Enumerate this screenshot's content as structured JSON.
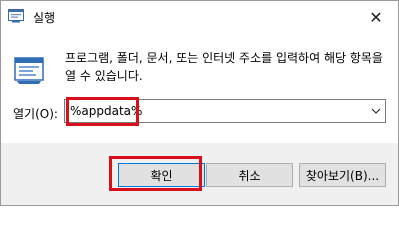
{
  "window": {
    "title": "실행",
    "close_symbol": "✕"
  },
  "dialog": {
    "description": "프로그램, 폴더, 문서, 또는 인터넷 주소를 입력하여 해당 항목을 열 수 있습니다.",
    "open_label": "열기(O):",
    "open_value": "%appdata%"
  },
  "buttons": {
    "ok": "확인",
    "cancel": "취소",
    "browse": "찾아보기(B)..."
  },
  "colors": {
    "highlight": "#d9101c",
    "footer_bg": "#f0f0f0",
    "default_button_border": "#0078d7"
  }
}
